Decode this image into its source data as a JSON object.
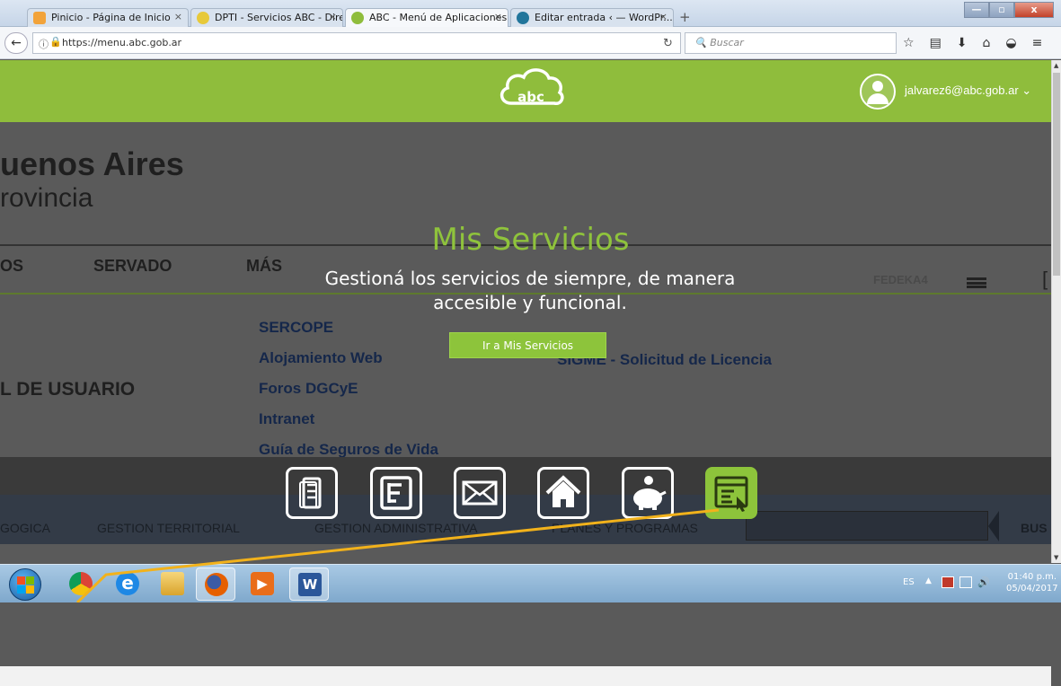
{
  "browser": {
    "tabs": [
      {
        "label": "Pinicio - Página de Inicio",
        "favicon": "home-icon"
      },
      {
        "label": "DPTI - Servicios ABC - Dire...",
        "favicon": "yellow-dot-icon"
      },
      {
        "label": "ABC - Menú de Aplicaciones",
        "favicon": "abc-cloud-icon"
      },
      {
        "label": "Editar entrada ‹ — WordPr...",
        "favicon": "wordpress-icon"
      }
    ],
    "tab_close": "×",
    "new_tab": "+",
    "url": "https://menu.abc.gob.ar",
    "search_placeholder": "Buscar",
    "window_controls": {
      "minimize": "—",
      "maximize": "▫",
      "close": "x"
    }
  },
  "header": {
    "logo_text": "abc",
    "user_email": "jalvarez6@abc.gob.ar",
    "accent_color": "#8fbd3c"
  },
  "background_page": {
    "brand_line1": "uenos Aires",
    "brand_line2": "rovincia",
    "menu": [
      "OS",
      "SERVADO",
      "MÁS"
    ],
    "blurred_label": "FEDEKA4",
    "bracket": "[",
    "links": [
      "SERCOPE",
      "Alojamiento Web",
      "Foros DGCyE",
      "Intranet",
      "Guía de Seguros de Vida"
    ],
    "usuario": "L DE USUARIO",
    "sigme": "SIGME - Solicitud de Licencia",
    "nav": [
      "GOGICA",
      "GESTION TERRITORIAL",
      "GESTION ADMINISTRATIVA",
      "PLANES Y PROGRAMAS"
    ],
    "search_tab": "BUS"
  },
  "overlay": {
    "title": "Mis Servicios",
    "subtitle_line1": "Gestioná los servicios de siempre, de manera",
    "subtitle_line2": "accesible y funcional.",
    "button": "Ir a Mis Servicios",
    "services": [
      {
        "icon": "checklist-icon",
        "selected": false
      },
      {
        "icon": "organization-chart-icon",
        "selected": false
      },
      {
        "icon": "mail-icon",
        "selected": false
      },
      {
        "icon": "home-icon",
        "selected": false
      },
      {
        "icon": "piggy-bank-icon",
        "selected": false
      },
      {
        "icon": "web-service-icon",
        "selected": true
      }
    ]
  },
  "taskbar": {
    "language": "ES",
    "time": "01:40 p.m.",
    "date": "05/04/2017",
    "apps": [
      "chrome-icon",
      "internet-explorer-icon",
      "file-explorer-icon",
      "firefox-icon",
      "media-player-icon",
      "word-icon"
    ]
  }
}
